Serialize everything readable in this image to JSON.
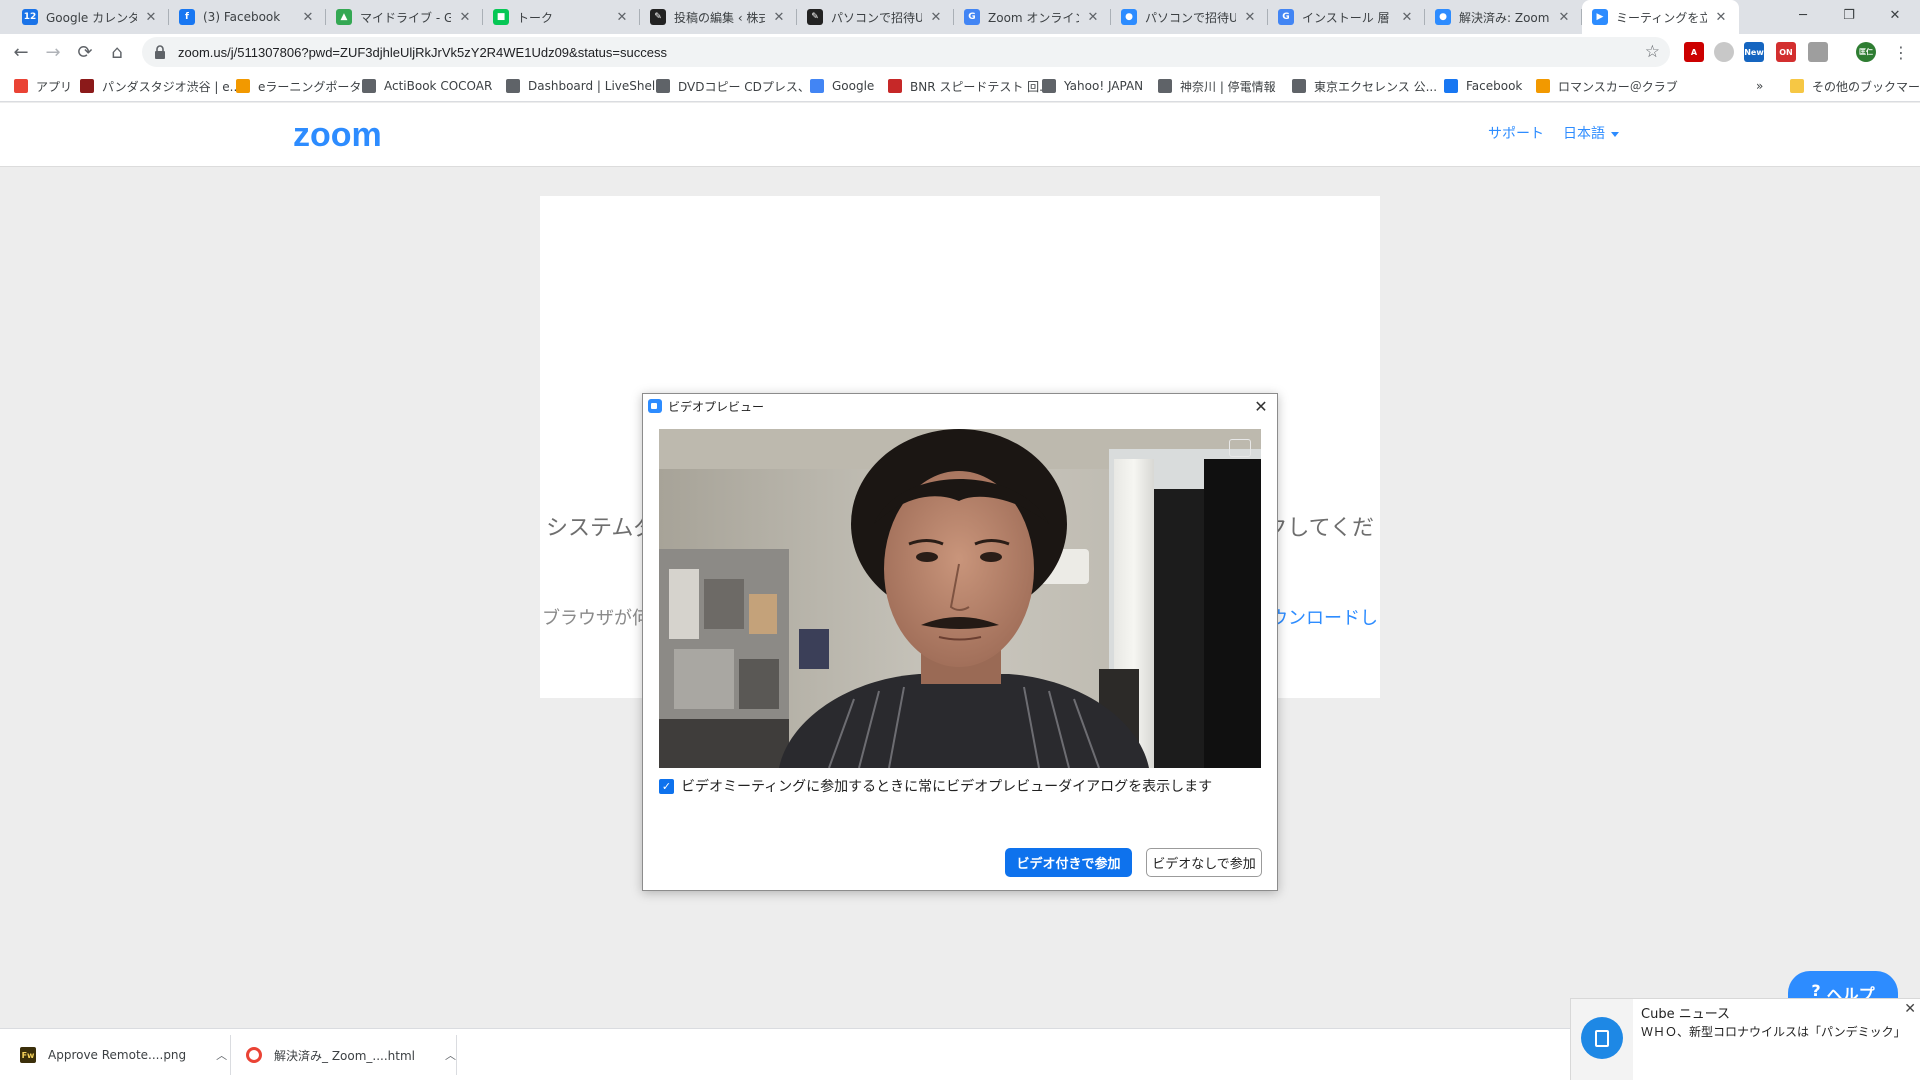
{
  "tabs": [
    {
      "title": "Google カレンダー",
      "icon_text": "12",
      "icon_color": "#1a73e8"
    },
    {
      "title": "(3) Facebook",
      "icon_text": "f",
      "icon_color": "#1877f2"
    },
    {
      "title": "マイドライブ - Goo",
      "icon_text": "▲",
      "icon_color": "#34a853"
    },
    {
      "title": "トーク",
      "icon_text": "■",
      "icon_color": "#06c755"
    },
    {
      "title": "投稿の編集 ‹ 株式",
      "icon_text": "✎",
      "icon_color": "#222222"
    },
    {
      "title": "パソコンで招待UR",
      "icon_text": "✎",
      "icon_color": "#222222"
    },
    {
      "title": "Zoom オンライン会",
      "icon_text": "G",
      "icon_color": "#4285f4"
    },
    {
      "title": "パソコンで招待UR",
      "icon_text": "●",
      "icon_color": "#2d8cff"
    },
    {
      "title": "インストール 層 マ",
      "icon_text": "G",
      "icon_color": "#4285f4"
    },
    {
      "title": "解決済み: Zoom",
      "icon_text": "●",
      "icon_color": "#2d8cff"
    },
    {
      "title": "ミーティングを立ち上",
      "icon_text": "▶",
      "icon_color": "#2d8cff",
      "active": true
    }
  ],
  "toolbar": {
    "url": "zoom.us/j/511307806?pwd=ZUF3djhleUljRkJrVk5zY2R4WE1Udz09&status=success",
    "back_icon": "←",
    "forward_icon": "→",
    "reload_icon": "⟳",
    "home_icon": "⌂",
    "bookmark_star": "☆",
    "menu_icon": "⋮",
    "ext_new": "New",
    "ext_on": "ON",
    "profile_label": "匡仁"
  },
  "bookmarks": [
    {
      "label": "アプリ",
      "icon_color": "#ea4335"
    },
    {
      "label": "パンダスタジオ渋谷 | e...",
      "icon_color": "#8b1a1a"
    },
    {
      "label": "eラーニングポータル",
      "icon_color": "#f29900"
    },
    {
      "label": "ActiBook COCOAR",
      "icon_color": "#5f6368"
    },
    {
      "label": "Dashboard | LiveShell",
      "icon_color": "#5f6368"
    },
    {
      "label": "DVDコピー CDプレス、...",
      "icon_color": "#5f6368"
    },
    {
      "label": "Google",
      "icon_color": "#4285f4"
    },
    {
      "label": "BNR スピードテスト 回...",
      "icon_color": "#c62828"
    },
    {
      "label": "Yahoo! JAPAN",
      "icon_color": "#5f6368"
    },
    {
      "label": "神奈川 | 停電情報",
      "icon_color": "#5f6368"
    },
    {
      "label": "東京エクセレンス 公...",
      "icon_color": "#5f6368"
    },
    {
      "label": "Facebook",
      "icon_color": "#1877f2"
    },
    {
      "label": "ロマンスカー＠クラブ",
      "icon_color": "#f29900"
    }
  ],
  "bookmarks_overflow": "»",
  "other_bookmarks": "その他のブックマーク",
  "zoom": {
    "logo": "zoom",
    "support": "サポート",
    "language": "日本語",
    "card_line1_left": "システムダ",
    "card_line1_right": "クしてくだ",
    "card_line2_left": "ブラウザが何",
    "card_line2_right": "ウンロードし",
    "help": "ヘルプ",
    "brand_color": "#2d8cff"
  },
  "dialog": {
    "title": "ビデオプレビュー",
    "checkbox_label": "ビデオミーティングに参加するときに常にビデオプレビューダイアログを表示します",
    "checkbox_checked": true,
    "join_with_video": "ビデオ付きで参加",
    "join_without_video": "ビデオなしで参加"
  },
  "downloads": [
    {
      "name": "Approve Remote....png",
      "icon_text": "Fw"
    },
    {
      "name": "解決済み_ Zoom_....html",
      "icon_text": "●"
    }
  ],
  "toast": {
    "title": "Cube ニュース",
    "body": "ＷＨＯ、新型コロナウイルスは「パンデミック」"
  }
}
